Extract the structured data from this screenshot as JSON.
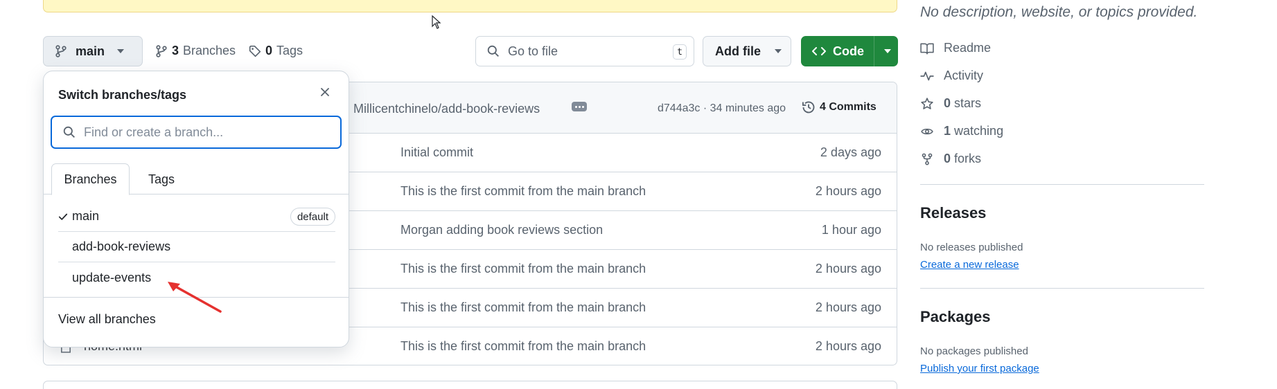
{
  "branch_selector": {
    "current": "main"
  },
  "meta": {
    "branches_count": "3",
    "branches_label": "Branches",
    "tags_count": "0",
    "tags_label": "Tags"
  },
  "search": {
    "placeholder": "Go to file",
    "shortcut": "t"
  },
  "toolbar": {
    "add_file": "Add file",
    "code": "Code"
  },
  "latest_commit": {
    "message": "Millicentchinelo/add-book-reviews",
    "hash_time": "d744a3c · 34 minutes ago",
    "commits": "4 Commits"
  },
  "files": [
    {
      "name": "",
      "message": "Initial commit",
      "age": "2 days ago"
    },
    {
      "name": "",
      "message": "This is the first commit from the main branch",
      "age": "2 hours ago"
    },
    {
      "name": "",
      "message": "Morgan adding book reviews section",
      "age": "1 hour ago"
    },
    {
      "name": "",
      "message": "This is the first commit from the main branch",
      "age": "2 hours ago"
    },
    {
      "name": "",
      "message": "This is the first commit from the main branch",
      "age": "2 hours ago"
    },
    {
      "name": "home.html",
      "message": "This is the first commit from the main branch",
      "age": "2 hours ago"
    }
  ],
  "dropdown": {
    "title": "Switch branches/tags",
    "search_placeholder": "Find or create a branch...",
    "tab_branches": "Branches",
    "tab_tags": "Tags",
    "branches": [
      {
        "name": "main",
        "badge": "default",
        "selected": true
      },
      {
        "name": "add-book-reviews"
      },
      {
        "name": "update-events"
      }
    ],
    "footer": "View all branches"
  },
  "sidebar": {
    "about": "No description, website, or topics provided.",
    "readme": "Readme",
    "activity": "Activity",
    "stars_count": "0",
    "stars_label": "stars",
    "watching_count": "1",
    "watching_label": "watching",
    "forks_count": "0",
    "forks_label": "forks",
    "releases_title": "Releases",
    "releases_none": "No releases published",
    "releases_link": "Create a new release",
    "packages_title": "Packages",
    "packages_none": "No packages published",
    "packages_link": "Publish your first package"
  },
  "colors": {
    "accent": "#0969da",
    "code_button": "#1f883d",
    "banner": "#fff8c5",
    "annotation_arrow": "#e5312f"
  }
}
